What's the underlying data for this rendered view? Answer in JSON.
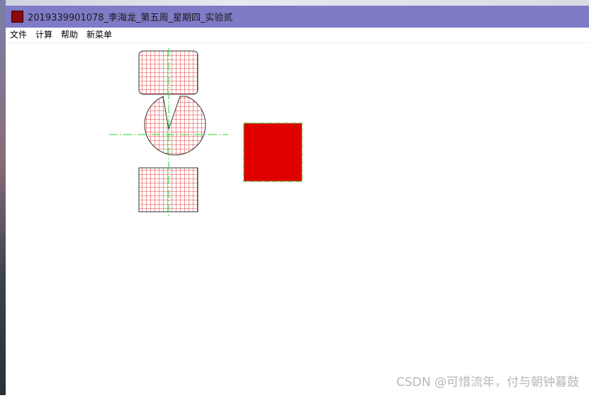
{
  "window": {
    "title": "2019339901078_李海龙_第五周_星期四_实验贰",
    "icon": "app-icon"
  },
  "menu": [
    {
      "label": "文件"
    },
    {
      "label": "计算"
    },
    {
      "label": "帮助"
    },
    {
      "label": "新菜单"
    }
  ],
  "colors": {
    "titlebar": "#7f7bc6",
    "hatch": "#e00000",
    "square_fill": "#e00000",
    "centerline": "#22dd22",
    "outline": "#333333"
  },
  "watermark": "CSDN @可惜流年，付与朝钟暮鼓"
}
